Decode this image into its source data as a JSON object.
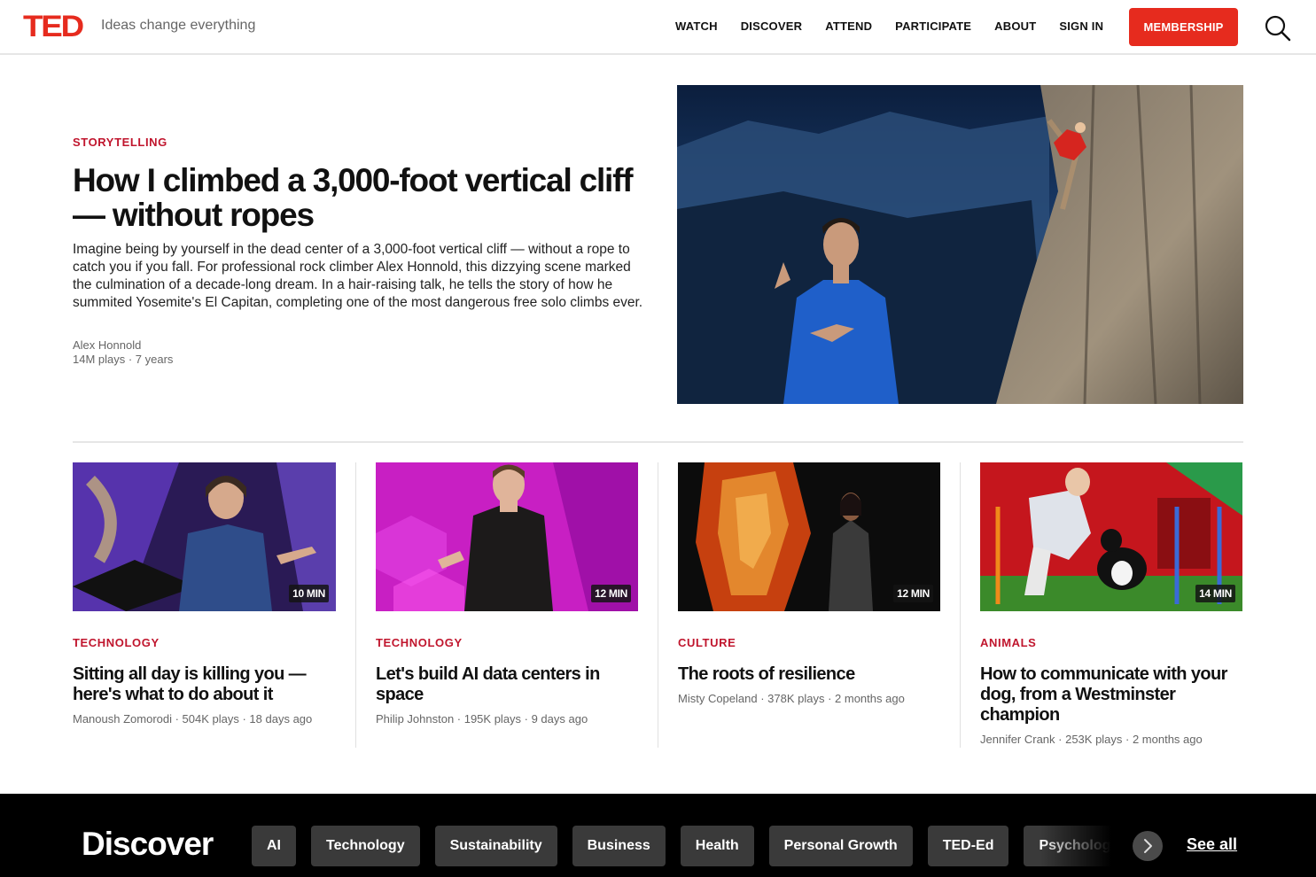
{
  "header": {
    "logo": "TED",
    "tagline": "Ideas change everything",
    "nav": [
      "WATCH",
      "DISCOVER",
      "ATTEND",
      "PARTICIPATE",
      "ABOUT",
      "SIGN IN"
    ],
    "membership_label": "MEMBERSHIP",
    "search_icon": "search-icon"
  },
  "hero": {
    "kicker": "STORYTELLING",
    "title": "How I climbed a 3,000-foot vertical cliff — without ropes",
    "description": "Imagine being by yourself in the dead center of a 3,000-foot vertical cliff — without a rope to catch you if you fall. For professional rock climber Alex Honnold, this dizzying scene marked the culmination of a decade-long dream. In a hair-raising talk, he tells the story of how he summited Yosemite's El Capitan, completing one of the most dangerous free solo climbs ever.",
    "speaker": "Alex Honnold",
    "stats": "14M plays · 7 years"
  },
  "cards": [
    {
      "duration": "10 MIN",
      "kicker": "TECHNOLOGY",
      "title": "Sitting all day is killing you — here's what to do about it",
      "meta": "Manoush Zomorodi · 504K plays · 18 days ago"
    },
    {
      "duration": "12 MIN",
      "kicker": "TECHNOLOGY",
      "title": "Let's build AI data centers in space",
      "meta": "Philip Johnston · 195K plays · 9 days ago"
    },
    {
      "duration": "12 MIN",
      "kicker": "CULTURE",
      "title": "The roots of resilience",
      "meta": "Misty Copeland · 378K plays · 2 months ago"
    },
    {
      "duration": "14 MIN",
      "kicker": "ANIMALS",
      "title": "How to communicate with your dog, from a Westminster champion",
      "meta": "Jennifer Crank · 253K plays · 2 months ago"
    }
  ],
  "discover": {
    "title": "Discover",
    "chips": [
      "AI",
      "Technology",
      "Sustainability",
      "Business",
      "Health",
      "Personal Growth",
      "TED-Ed",
      "Psychology"
    ],
    "see_all": "See all",
    "next_icon": "chevron-right-icon"
  },
  "colors": {
    "brand_red": "#e62b1e",
    "kicker_red": "#c0152d",
    "chip_bg": "#3a3a3a"
  }
}
